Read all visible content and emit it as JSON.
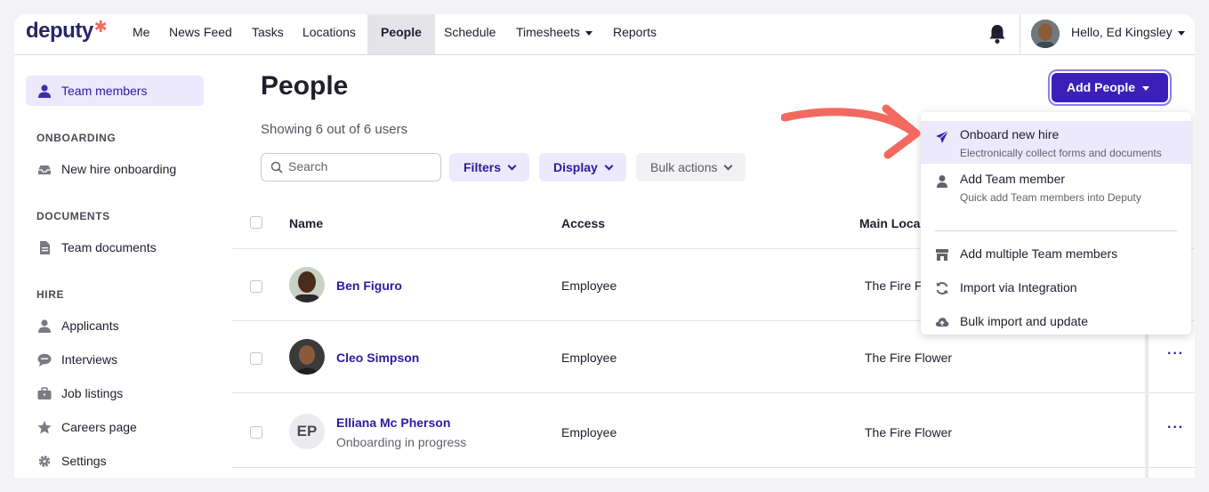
{
  "nav": {
    "logo": "deputy",
    "items": [
      "Me",
      "News Feed",
      "Tasks",
      "Locations",
      "People",
      "Schedule",
      "Timesheets",
      "Reports"
    ],
    "active": "People",
    "greeting": "Hello, Ed Kingsley"
  },
  "sidebar": {
    "team_members": "Team members",
    "onboarding_heading": "ONBOARDING",
    "new_hire_onboarding": "New hire onboarding",
    "documents_heading": "DOCUMENTS",
    "team_documents": "Team documents",
    "hire_heading": "HIRE",
    "applicants": "Applicants",
    "interviews": "Interviews",
    "job_listings": "Job listings",
    "careers_page": "Careers page",
    "settings": "Settings"
  },
  "main": {
    "title": "People",
    "showing": "Showing 6 out of 6 users",
    "search_placeholder": "Search",
    "filters": "Filters",
    "display": "Display",
    "bulk_actions": "Bulk actions",
    "add_people": "Add People"
  },
  "table": {
    "headers": {
      "name": "Name",
      "access": "Access",
      "location": "Main Loca"
    },
    "rows": [
      {
        "name": "Ben Figuro",
        "access": "Employee",
        "location": "The Fire F"
      },
      {
        "name": "Cleo Simpson",
        "access": "Employee",
        "location": "The Fire Flower"
      },
      {
        "name": "Elliana Mc Pherson",
        "initials": "EP",
        "status": "Onboarding in progress",
        "access": "Employee",
        "location": "The Fire Flower"
      }
    ],
    "more": "···"
  },
  "menu": {
    "onboard": {
      "label": "Onboard new hire",
      "sub": "Electronically collect forms and documents"
    },
    "add_member": {
      "label": "Add Team member",
      "sub": "Quick add Team members into Deputy"
    },
    "add_multiple": "Add multiple Team members",
    "import_integration": "Import via Integration",
    "bulk_import": "Bulk import and update"
  },
  "colors": {
    "brand": "#3a1fb8",
    "accent_light": "#ebe9fb",
    "arrow": "#f26a5f"
  }
}
